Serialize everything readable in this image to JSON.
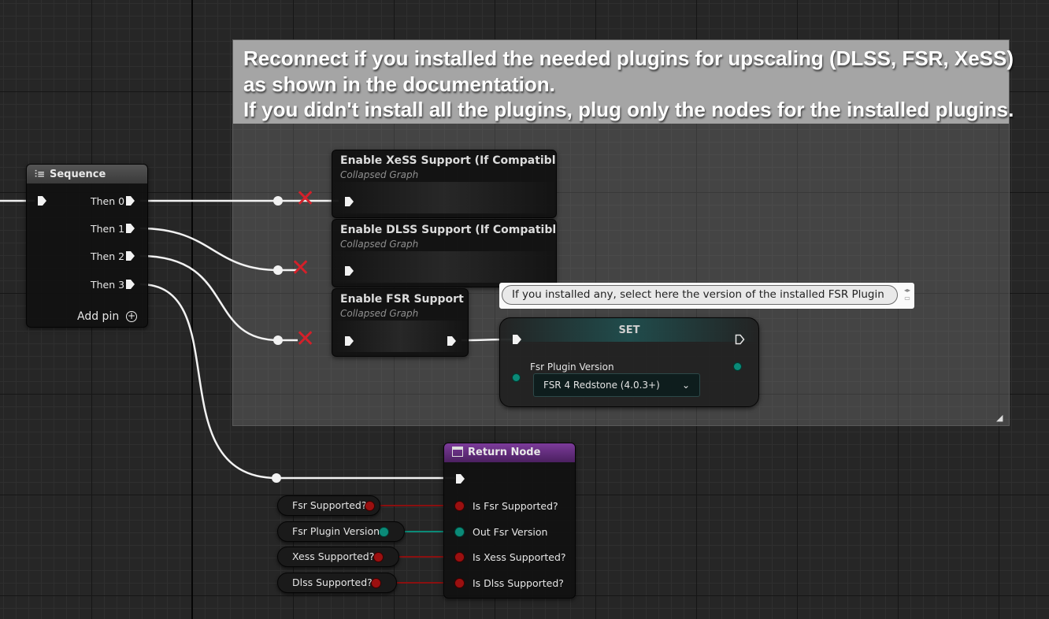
{
  "comment": {
    "lines": [
      "Reconnect if you installed the needed plugins for upscaling (DLSS, FSR, XeSS)",
      "as shown in the documentation.",
      "If you didn't install all the plugins, plug only the nodes for the installed plugins."
    ]
  },
  "sequence": {
    "title": "Sequence",
    "pins": [
      "Then 0",
      "Then 1",
      "Then 2",
      "Then 3"
    ],
    "add_pin": "Add pin"
  },
  "collapsed_graphs": [
    {
      "title": "Enable XeSS Support (If Compatible)",
      "subtitle": "Collapsed Graph"
    },
    {
      "title": "Enable DLSS Support (If Compatible)",
      "subtitle": "Collapsed Graph"
    },
    {
      "title": "Enable FSR Support",
      "subtitle": "Collapsed Graph"
    }
  ],
  "tooltip": {
    "text": "If you installed any, select here the version of the installed FSR Plugin"
  },
  "set_node": {
    "title": "SET",
    "variable": "Fsr Plugin Version",
    "selected": "FSR 4 Redstone (4.0.3+)"
  },
  "return_node": {
    "title": "Return Node",
    "pins": [
      "Is Fsr Supported?",
      "Out Fsr Version",
      "Is Xess Supported?",
      "Is Dlss Supported?"
    ]
  },
  "getters": [
    "Fsr Supported?",
    "Fsr Plugin Version",
    "Xess Supported?",
    "Dlss Supported?"
  ],
  "colors": {
    "bool_pin": "#9b1010",
    "enum_pin": "#0b8a78",
    "exec_wire": "#f2f2f2",
    "disconnected_mark": "#d4202a",
    "comment_header": "#a5a5a5"
  }
}
